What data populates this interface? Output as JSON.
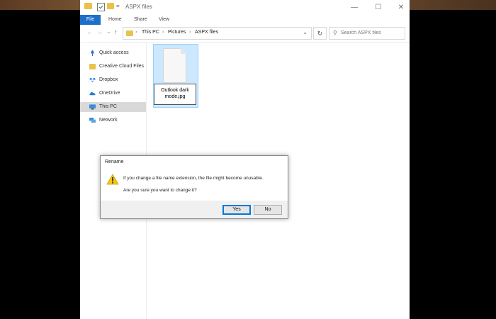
{
  "window": {
    "title": "ASPX files",
    "controls": {
      "minimize": "—",
      "maximize": "☐",
      "close": "✕"
    }
  },
  "quick_access_toolbar": {
    "dropdown": "="
  },
  "ribbon": {
    "tabs": [
      {
        "label": "File"
      },
      {
        "label": "Home"
      },
      {
        "label": "Share"
      },
      {
        "label": "View"
      }
    ]
  },
  "navigation": {
    "back": "←",
    "forward": "→",
    "up_dropdown": "⌄",
    "up": "↑"
  },
  "address_bar": {
    "crumbs": [
      "This PC",
      "Pictures",
      "ASPX files"
    ],
    "separator": "›",
    "dropdown": "⌄",
    "refresh": "↻"
  },
  "search": {
    "placeholder": "Search ASPX files",
    "icon": "⚲"
  },
  "nav_pane": {
    "items": [
      {
        "label": "Quick access",
        "icon": "pin-icon",
        "color": "#2a6fd6"
      },
      {
        "label": "Creative Cloud Files",
        "icon": "creative-cloud-icon",
        "color": "#e8c24a"
      },
      {
        "label": "Dropbox",
        "icon": "dropbox-icon",
        "color": "#2d7de0"
      },
      {
        "label": "OneDrive",
        "icon": "onedrive-icon",
        "color": "#1f7fd6"
      },
      {
        "label": "This PC",
        "icon": "computer-icon",
        "color": "#3a8fd9",
        "selected": true
      },
      {
        "label": "Network",
        "icon": "network-icon",
        "color": "#3a8fd9"
      }
    ]
  },
  "content": {
    "file": {
      "name_editing": "Outlook dark mode.jpg"
    }
  },
  "dialog": {
    "title": "Rename",
    "message_line1": "If you change a file name extension, the file might become unusable.",
    "message_line2": "Are you sure you want to change it?",
    "yes_label": "Yes",
    "no_label": "No"
  },
  "colors": {
    "accent": "#1e6fc8",
    "selection": "#cce8ff",
    "warning": "#f2c811"
  }
}
